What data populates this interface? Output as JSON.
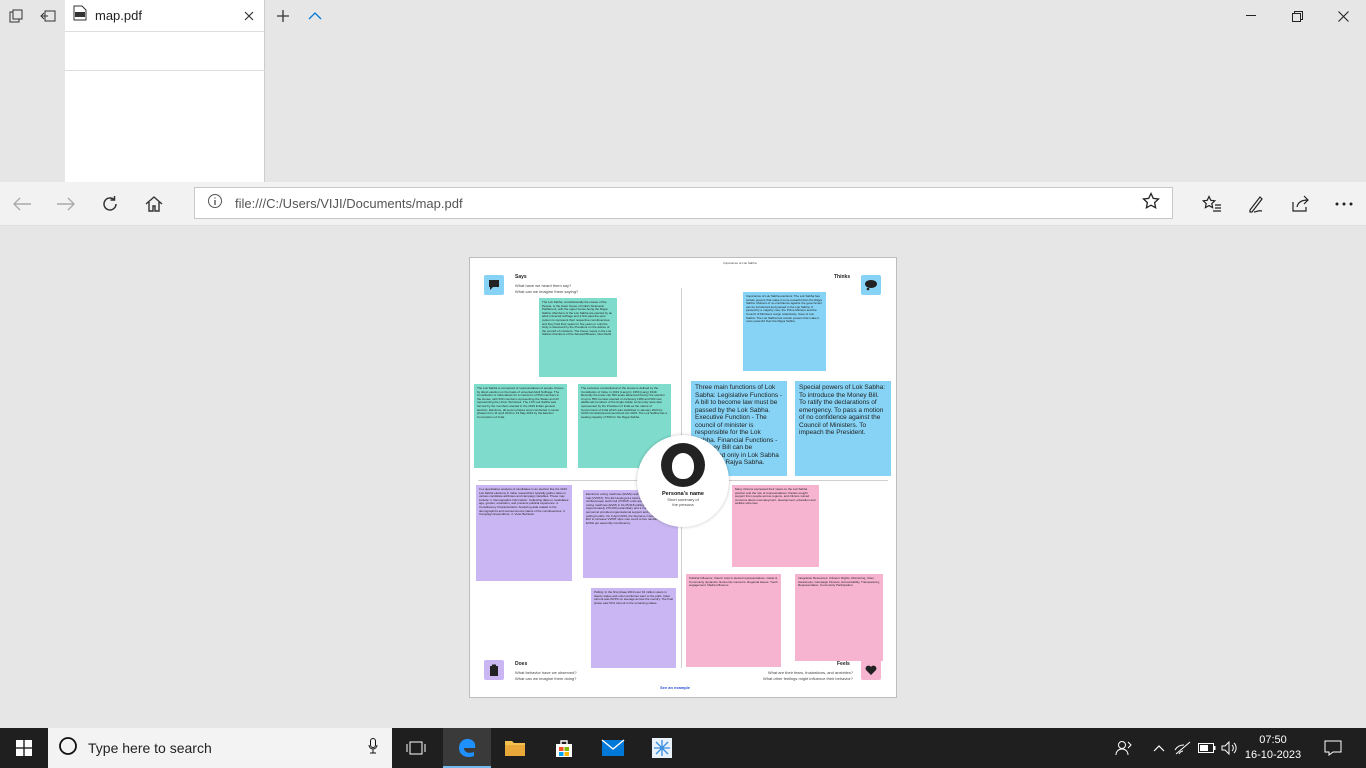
{
  "browser": {
    "tab": {
      "title": "map.pdf"
    },
    "address_bar": {
      "url": "file:///C:/Users/VIJI/Documents/map.pdf"
    }
  },
  "colors": {
    "teal": "#7fdccc",
    "blue": "#86d3f5",
    "purple": "#c9b6f2",
    "pink": "#f7b4d1",
    "taskbar": "#1f1f1f",
    "accent": "#0078d7"
  },
  "pdf": {
    "header_small": "Importance of Lok Sabha",
    "says": {
      "title": "Says",
      "sub1": "What have we heard them say?",
      "sub2": "What can we imagine them saying?"
    },
    "thinks": {
      "title": "Thinks"
    },
    "does": {
      "title": "Does",
      "sub1": "What behavior have we observed?",
      "sub2": "What can we imagine them doing?"
    },
    "feels": {
      "title": "Feels",
      "sub1": "What are their fears, frustrations, and anxieties?",
      "sub2": "What other feelings might influence their behavior?"
    },
    "persona": {
      "name": "Persona's name",
      "summary1": "Short summary of",
      "summary2": "the persona"
    },
    "example_link": "See an example",
    "notes": {
      "says_1": "The Lok Sabha, constitutionally the House of the People, is the lower house of India's bicameral Parliament, with the upper house being the Rajya Sabha. Members of the Lok Sabha are elected by an adult universal suffrage and a first-past-the-post system to represent their respective constituencies, and they hold their seats for five years or until the body is dissolved by the President on the advice of the council of ministers. The house meets in the Lok Sabha Chambers of the Sansad Bhavan, New Delhi.",
      "says_2": "The Lok Sabha is composed of representatives of people chosen by direct election on the basis of universal Adult Suffrage. The Constitution of India allows for a maximum of 550 members in the House, with 530 members representing the States and 20 representing the Union Territories. The 17th Lok Sabha was formed by the members elected in the 2019 Indian general election. Elections, all seven phases were conducted in seven phases from 11 April 2019 to 19 May 2019 by the Election Commission of India.",
      "says_3": "The exclusive constitutional of the House is defined by the Constitution of India. In 2019 (Lang) in 1950 (Lang) 1949. Recently the lower clip 500 seats advanced that by the election of up to 550 member elected on February 1950 and 530 new additional members of the Anglo-Indian community were also represented by the President of India as the nature of Government of India which was stabilized in January 2020 by 104th Constitutional Amendment Act 2019. The Lok Sabha has a seating capacity of 550 for the Rajya Sabha.",
      "thinks_1": "Importance of Lok Sabha elections: The Lok Sabha has certain powers that make it more powerful than the Rajya Sabha. Motions of no-confidence against the government can be introduced and passed in the Lok Sabha. If passed by a majority vote, the Prime Minister and the Council of Ministers resign collectively. Uses of Lok Sabha: The Lok Sabha has certain powers that make it more powerful than the Rajya Sabha.",
      "thinks_2": "Three main functions of Lok Sabha: Legislative Functions - A bill to become law must be passed by the Lok Sabha. Executive Function - The council of minister is responsible for the Lok Sabha. Financial Functions - A money Bill can be introduced only in Lok Sabha and not in Rajya Sabha.",
      "thinks_3": "Special powers of Lok Sabha: To introduce the Money Bill. To ratify the declarations of emergency. To pass a motion of no confidence against the Council of Ministers. To impeach the President.",
      "does_1": "In a quantitative analysis of candidates in an election like the 2019 Lok Sabha elections in India, researchers typically gather data on various candidate attributes and campaign variables. These may include: 1. Demographic Information: Collecting data on candidates' age, gender, education, and previous political experience. 2. Constituency Characteristics: Analyzing data related to the demographics and socioeconomic status of the constituencies. 3. Campaign Expenditure. 4. Voter Behavior.",
      "does_2": "Electronic voting machines (EVMs) and Voter verified paper audit trail (VVPAT): The ECI deployed a total of 1.74 million voter verified paper audit trail (VVPAT) units and 2.33 million electronic voting machines (EVM) in 10,35,918 polling stations. Approximately 270,000 paramilitary and 2 million state police personnel provided organisational support and security at various polling booths. On 9 April 2019, the Supreme Court ordered the ECI to increase VVPAT slips vote count to five randomly selected EVMs per assembly constituency.",
      "does_3": "Polling: In the first phase 2019 over 91 million voters in twenty states and union territories went to the polls. Voter turnout was 69.5% on average across the country. The final phase saw 61% turnout in the remaining states.",
      "feels_1": "Many citizens expressed their views on the Lok Sabha election and the role of representatives. Parties sought support from people across regions, and citizens voiced concerns about unemployment, development, education and welfare schemes.",
      "feels_2": "Political Influence: Voters' trust in elected representatives. Caste & Community dynamics. Economic concerns. Regional issues. Youth engagement. Media influence.",
      "feels_3": "Integration Resources: Citizens' Rights, Monitoring, Voter Awareness, Campaign Finance, Accountability, Transparency, Representation, Community Participation."
    }
  },
  "taskbar": {
    "search_placeholder": "Type here to search",
    "time": "07:50",
    "date": "16-10-2023"
  }
}
